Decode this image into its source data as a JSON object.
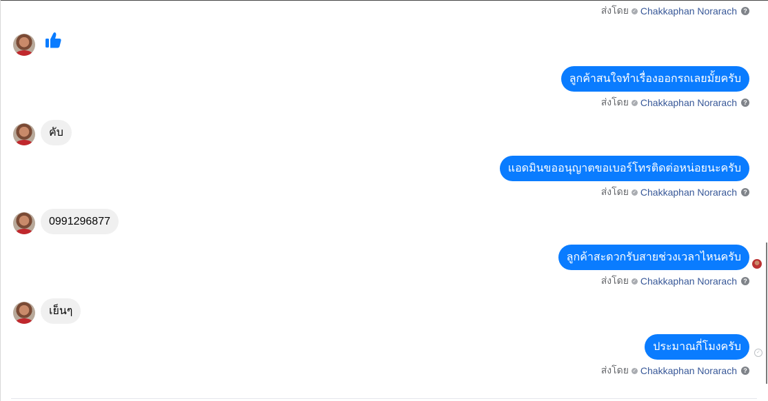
{
  "sent_by": {
    "prefix": "ส่งโดย",
    "name": "Chakkaphan Norarach",
    "help_symbol": "?"
  },
  "messages": [
    {
      "from": "customer",
      "type": "sticker",
      "icon": "thumbs-up-icon",
      "color": "#0a7cff"
    },
    {
      "from": "page",
      "text": "ลูกค้าสนใจทำเรื่องออกรถเลยมั้ยครับ"
    },
    {
      "from": "customer",
      "text": "คับ"
    },
    {
      "from": "page",
      "text": "แอดมินขออนุญาตขอเบอร์โทรติดต่อหน่อยนะครับ"
    },
    {
      "from": "customer",
      "text": "0991296877"
    },
    {
      "from": "page",
      "text": "ลูกค้าสะดวกรับสายช่วงเวลาไหนครับ"
    },
    {
      "from": "customer",
      "text": "เย็นๆ"
    },
    {
      "from": "page",
      "text": "ประมาณกี่โมงครับ"
    }
  ],
  "colors": {
    "outgoing_bubble": "#0a7cff",
    "incoming_bubble": "#f0f0f0",
    "sender_name": "#385898"
  }
}
